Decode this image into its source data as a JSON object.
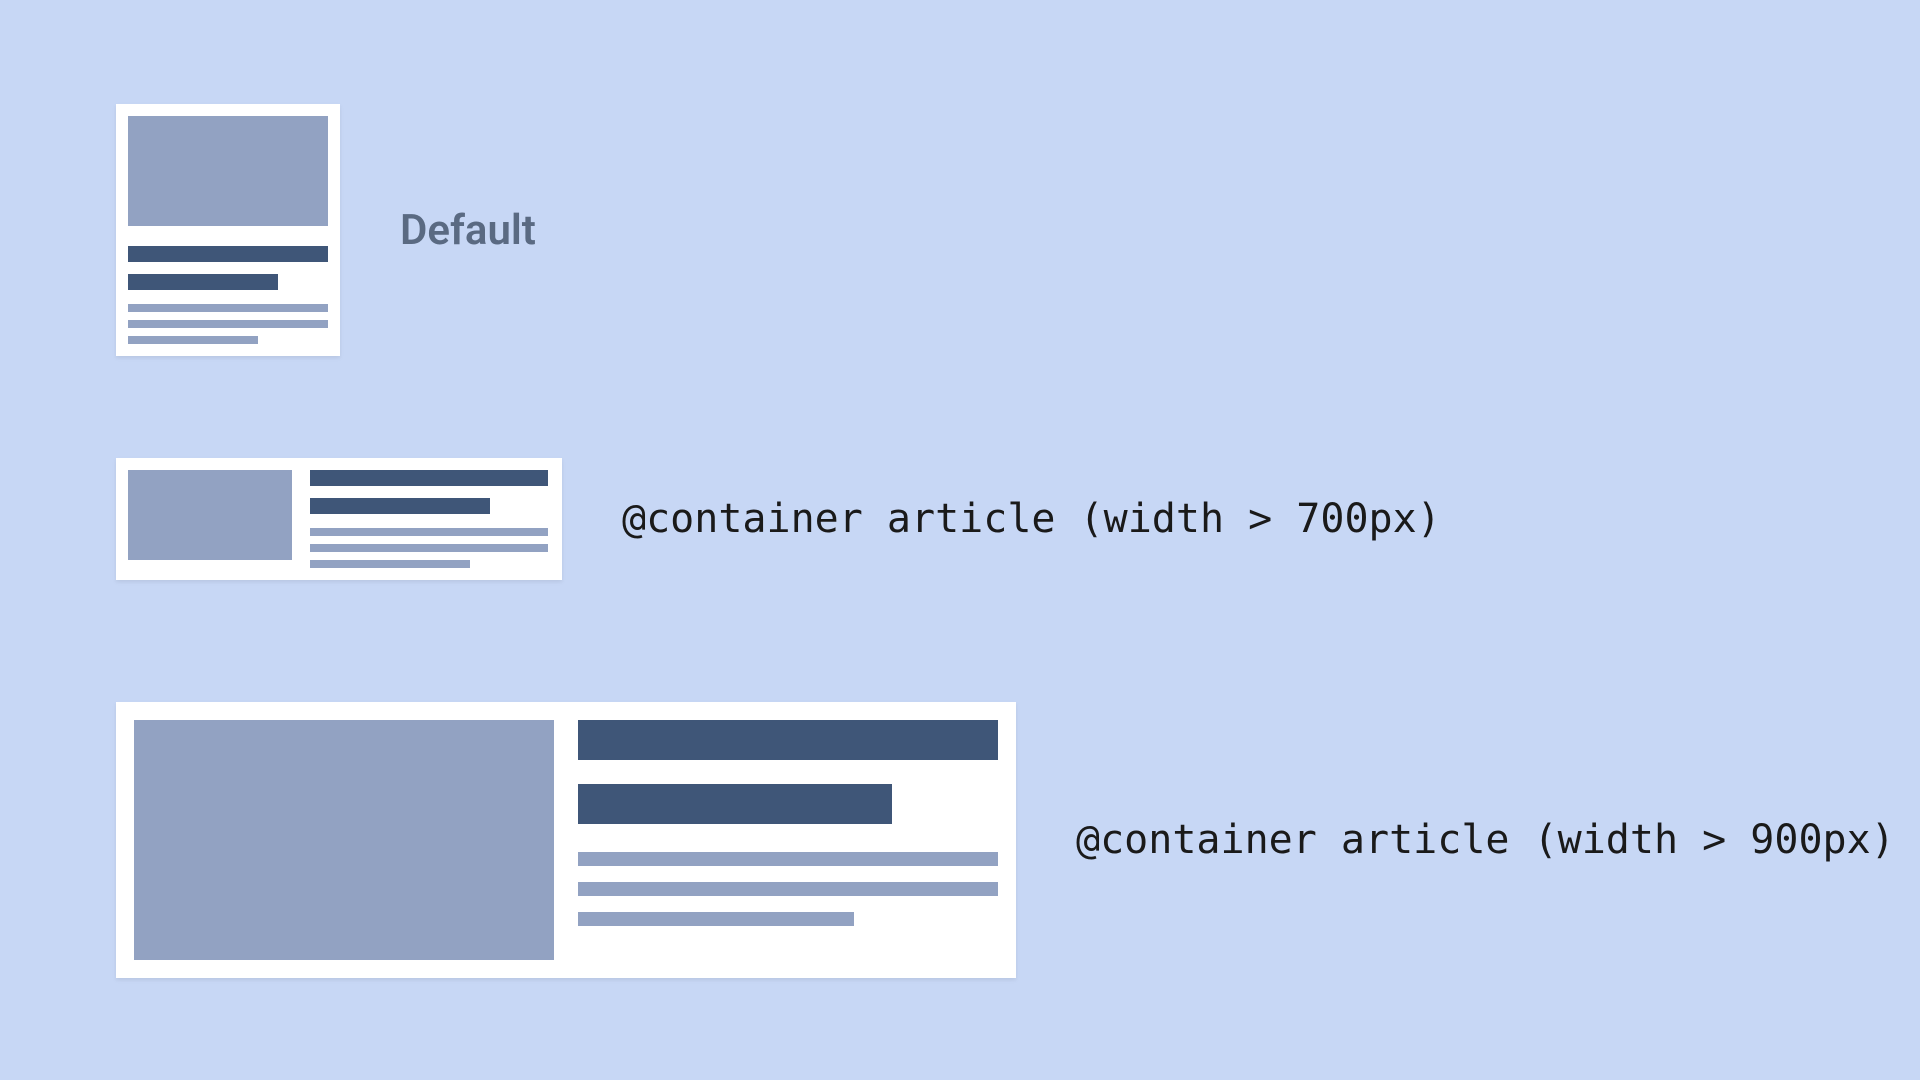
{
  "labels": {
    "default": "Default",
    "q700": "@container article (width > 700px)",
    "q900": "@container article (width > 900px)"
  },
  "colors": {
    "background": "#c7d7f5",
    "card_bg": "#ffffff",
    "bar_dark": "#3f5678",
    "bar_light": "#92a2c2",
    "label_muted": "#5a6a82",
    "label_code": "#1a1a1a"
  },
  "breakpoints": [
    {
      "name": "default",
      "condition": null,
      "layout": "stacked"
    },
    {
      "name": "medium",
      "condition": "width > 700px",
      "layout": "row-small"
    },
    {
      "name": "large",
      "condition": "width > 900px",
      "layout": "row-large"
    }
  ]
}
